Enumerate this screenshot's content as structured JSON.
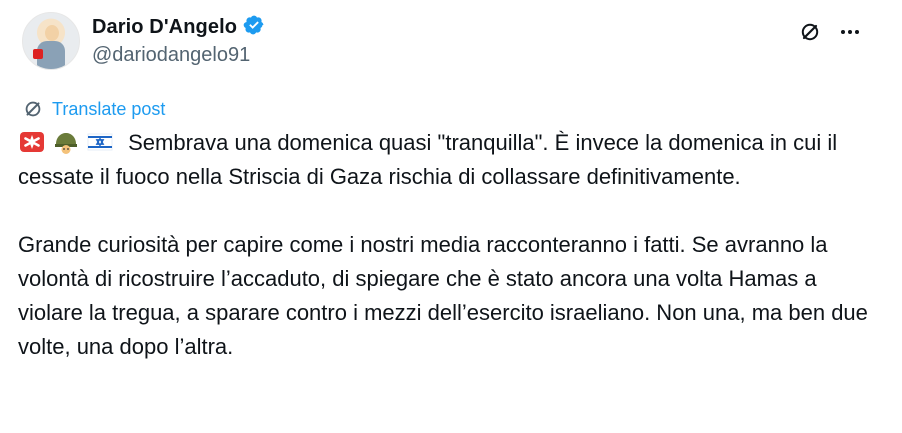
{
  "author": {
    "display_name": "Dario D'Angelo",
    "handle": "@dariodangelo91",
    "verified": true,
    "avatar_icon": "avatar-illustration"
  },
  "actions": {
    "grok_icon": "grok-icon",
    "more_icon": "more-icon"
  },
  "translate": {
    "label": "Translate post",
    "icon": "globe-translate-icon"
  },
  "post": {
    "emojis": [
      "police-light-emoji",
      "military-helmet-emoji",
      "israel-flag-emoji"
    ],
    "paragraph1_text": "Sembrava una domenica quasi \"tranquilla\". È invece la domenica in cui il cessate il fuoco nella Striscia di Gaza rischia di collassare definitivamente.",
    "paragraph2_text": "Grande curiosità per capire come i nostri media racconteranno i fatti. Se avranno la volontà di ricostruire l’accaduto, di spiegare che è stato ancora una volta Hamas a violare la tregua, a sparare contro i mezzi dell’esercito israeliano. Non una, ma ben due volte, una dopo l’altra."
  },
  "colors": {
    "text": "#0f1419",
    "secondary": "#536471",
    "link": "#1d9bf0",
    "verified": "#1d9bf0"
  }
}
